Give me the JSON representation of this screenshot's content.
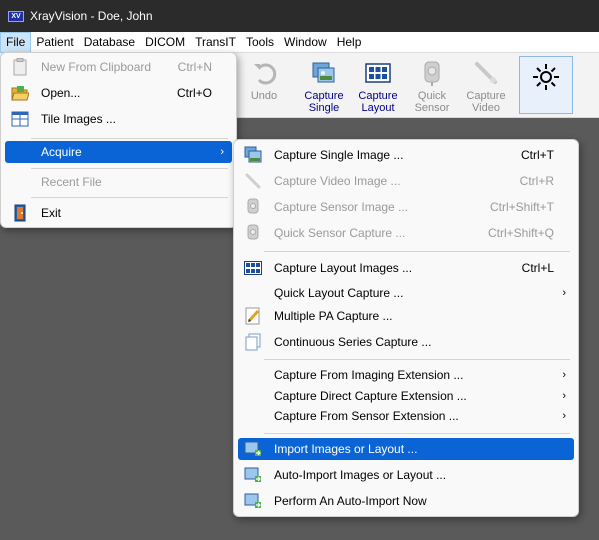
{
  "window": {
    "logo": "XV",
    "title": "XrayVision - Doe, John"
  },
  "menubar": [
    "File",
    "Patient",
    "Database",
    "DICOM",
    "TransIT",
    "Tools",
    "Window",
    "Help"
  ],
  "toolbar": {
    "undo": "Undo",
    "capture_single": "Capture\nSingle",
    "capture_layout": "Capture\nLayout",
    "quick_sensor": "Quick\nSensor",
    "capture_video": "Capture\nVideo",
    "last_button_icon": "sun-enhance-icon"
  },
  "file_menu": {
    "new_from_clipboard": {
      "label": "New From Clipboard",
      "shortcut": "Ctrl+N"
    },
    "open": {
      "label": "Open...",
      "shortcut": "Ctrl+O"
    },
    "tile_images": {
      "label": "Tile Images ..."
    },
    "acquire": {
      "label": "Acquire"
    },
    "recent_file": {
      "label": "Recent File"
    },
    "exit": {
      "label": "Exit"
    }
  },
  "acquire_menu": {
    "capture_single": {
      "label": "Capture Single Image ...",
      "shortcut": "Ctrl+T"
    },
    "capture_video": {
      "label": "Capture Video Image ...",
      "shortcut": "Ctrl+R"
    },
    "capture_sensor": {
      "label": "Capture Sensor Image ...",
      "shortcut": "Ctrl+Shift+T"
    },
    "quick_sensor": {
      "label": "Quick Sensor Capture ...",
      "shortcut": "Ctrl+Shift+Q"
    },
    "capture_layout": {
      "label": "Capture Layout Images ...",
      "shortcut": "Ctrl+L"
    },
    "quick_layout": {
      "label": "Quick Layout Capture ..."
    },
    "multiple_pa": {
      "label": "Multiple PA Capture ..."
    },
    "continuous_series": {
      "label": "Continuous Series Capture ..."
    },
    "from_imaging_ext": {
      "label": "Capture From Imaging Extension ..."
    },
    "direct_capture_ext": {
      "label": "Capture Direct Capture Extension ..."
    },
    "from_sensor_ext": {
      "label": "Capture From Sensor Extension ..."
    },
    "import_images": {
      "label": "Import Images or Layout ..."
    },
    "auto_import": {
      "label": "Auto-Import Images or Layout ..."
    },
    "perform_auto_import": {
      "label": "Perform An Auto-Import Now"
    }
  },
  "colors": {
    "highlight": "#0a64d6",
    "toolbar_label": "#00008b",
    "workspace": "#5a5a5a",
    "titlebar": "#2b2b2b"
  }
}
